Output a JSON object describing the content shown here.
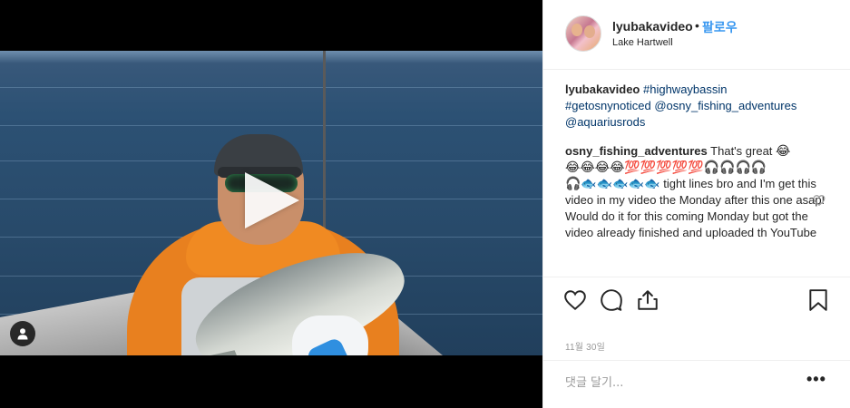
{
  "post": {
    "username": "lyubakavideo",
    "follow_separator": "•",
    "follow_label": "팔로우",
    "location": "Lake Hartwell",
    "caption": {
      "author": "lyubakavideo",
      "tags": [
        "#highwaybassin",
        "#getosnynoticed",
        "@osny_fishing_adventures",
        "@aquariusrods"
      ]
    },
    "comment": {
      "author": "osny_fishing_adventures",
      "text_start": "That's great",
      "emojis_line1": "😂",
      "emojis_line2": "😂😂😂😂💯💯💯💯💯🎧🎧🎧🎧",
      "emojis_line3": "🎧🐟🐟🐟🐟🐟",
      "text_rest": "tight lines bro and I'm get this video in my video the Monday after this one asap! Would do it for this coming Monday but got the video already finished and uploaded th YouTube"
    },
    "date": "11월 30일",
    "add_comment_placeholder": "댓글 달기...",
    "more_label": "•••"
  },
  "icons": {
    "play": "play-icon",
    "tag": "user-tag-icon",
    "like": "heart-icon",
    "comment": "comment-icon",
    "share": "share-icon",
    "save": "bookmark-icon",
    "comment_like": "heart-small-icon"
  },
  "colors": {
    "link": "#003569",
    "follow": "#3897f0",
    "muted": "#999999"
  }
}
